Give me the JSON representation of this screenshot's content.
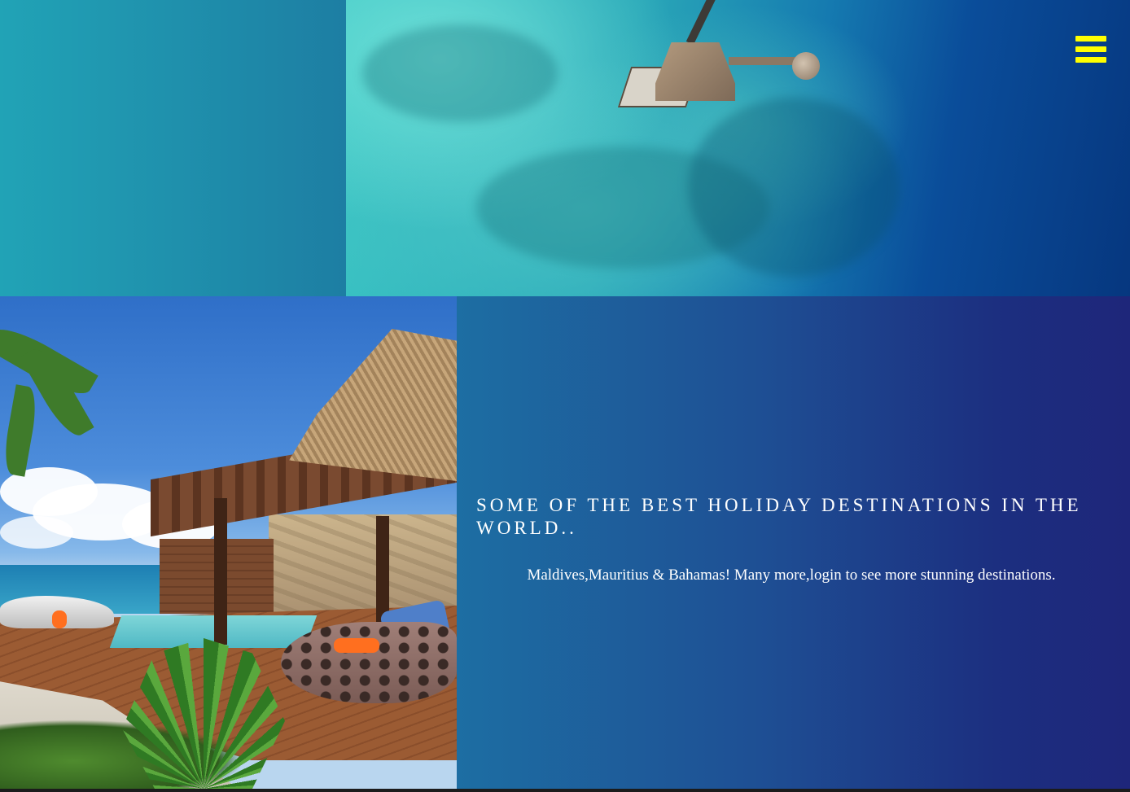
{
  "header": {
    "menu_icon": "hamburger-menu-icon",
    "menu_color": "#ffff00"
  },
  "images": {
    "top": "aerial-overwater-resort-photo",
    "bottom": "beach-villa-pool-photo"
  },
  "hero": {
    "headline": "Some of the best holiday destinations in the world..",
    "description": "Maldives,Mauritius & Bahamas! Many more,login to see more stunning destinations."
  },
  "colors": {
    "teal_panel": "#21a3b6",
    "text_panel_start": "#1d6ea3",
    "text_panel_end": "#1e267a",
    "text": "#ffffff"
  }
}
